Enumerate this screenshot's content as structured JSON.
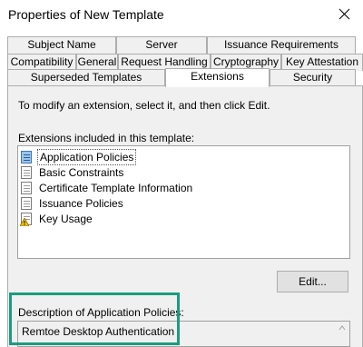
{
  "window": {
    "title": "Properties of New Template",
    "close_label": "✕"
  },
  "tabs": {
    "row1": [
      "Subject Name",
      "Server",
      "Issuance Requirements"
    ],
    "row2": [
      "Compatibility",
      "General",
      "Request Handling",
      "Cryptography",
      "Key Attestation"
    ],
    "row3": [
      "Superseded Templates",
      "Extensions",
      "Security"
    ],
    "active": "Extensions"
  },
  "extensions": {
    "instruction": "To modify an extension, select it, and then click Edit.",
    "list_label": "Extensions included in this template:",
    "items": [
      {
        "label": "Application Policies",
        "icon": "policy-doc-icon-blue",
        "selected": true
      },
      {
        "label": "Basic Constraints",
        "icon": "doc-icon"
      },
      {
        "label": "Certificate Template Information",
        "icon": "doc-icon"
      },
      {
        "label": "Issuance Policies",
        "icon": "doc-icon"
      },
      {
        "label": "Key Usage",
        "icon": "warning-doc-icon"
      }
    ],
    "edit_label": "Edit...",
    "description_label": "Description of Application Policies:",
    "description_text": "Remtoe Desktop Authentication"
  },
  "colors": {
    "highlight": "#1a9c7f",
    "tab_bg": "#f0f0f0",
    "panel_bg": "#f0f0f0"
  }
}
